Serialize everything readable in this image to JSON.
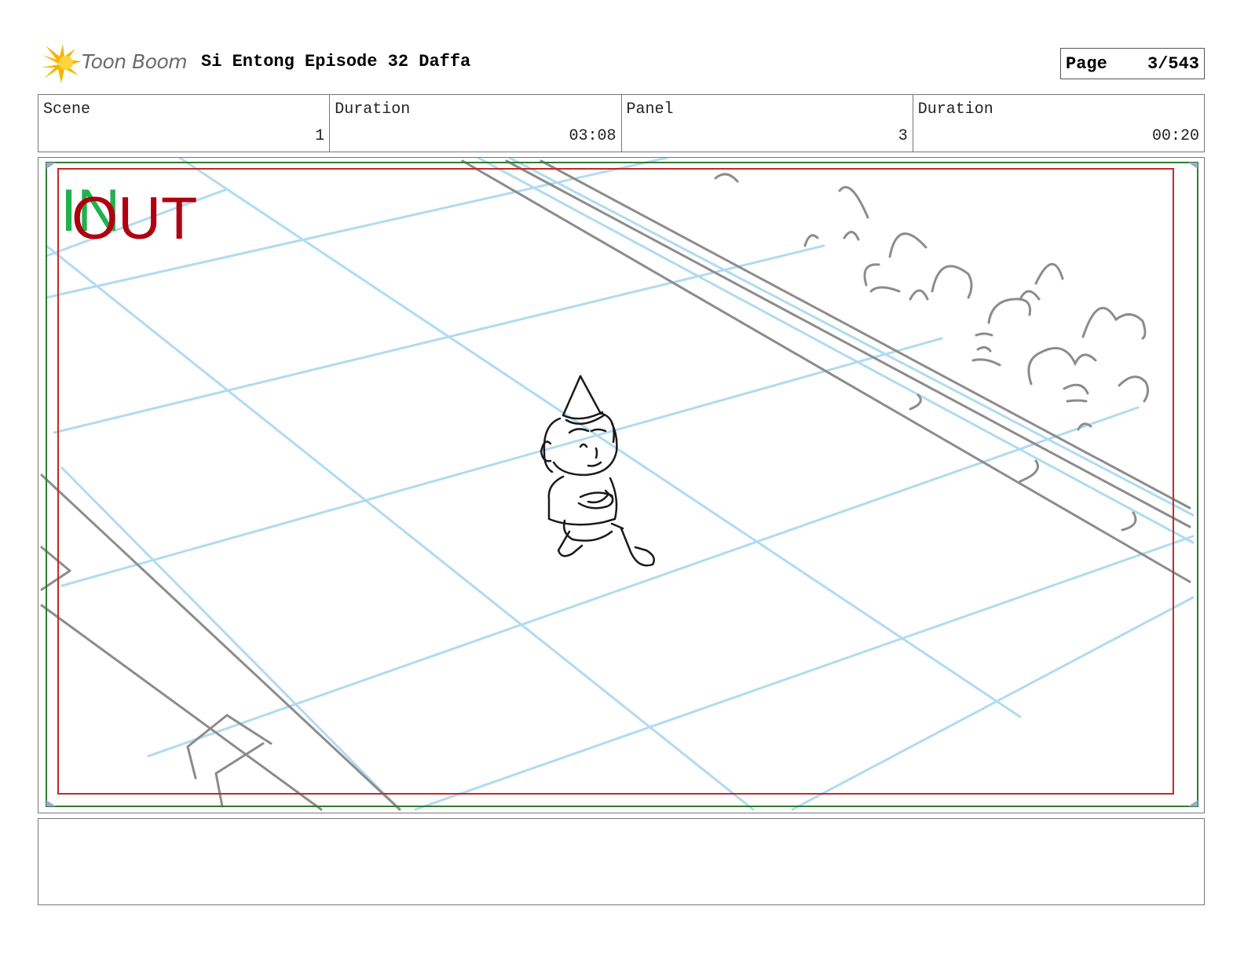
{
  "header": {
    "logo_text": "Toon Boom",
    "project_title": "Si Entong Episode 32 Daffa",
    "page_label": "Page",
    "page_value": "3/543"
  },
  "info": {
    "scene_label": "Scene",
    "scene_value": "1",
    "scene_duration_label": "Duration",
    "scene_duration_value": "03:08",
    "panel_label": "Panel",
    "panel_value": "3",
    "panel_duration_label": "Duration",
    "panel_duration_value": "00:20"
  },
  "panel": {
    "in_marker": "IN",
    "out_marker": "OUT",
    "colors": {
      "safe_frame": "#2e7d32",
      "title_safe": "#c62828",
      "perspective_grid": "#a8d8f0",
      "sketch_lines": "#8c8c8c",
      "character_lines": "#1a1a1a"
    }
  },
  "notes": {
    "text": ""
  }
}
